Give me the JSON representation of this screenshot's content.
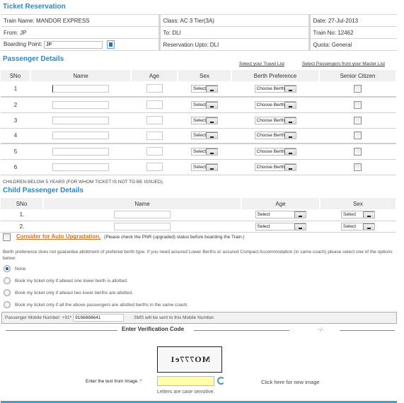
{
  "page_title": "Ticket Reservation",
  "train_info": {
    "train_name": "Train Name: MANDOR EXPRESS",
    "class": "Class: AC 3 Tier(3A)",
    "date": "Date: 27-Jul-2013",
    "from": "From: JP",
    "to": "To: DLI",
    "train_no": "Train No: 12462",
    "boarding_label": "Boarding Point:",
    "boarding_value": "JP",
    "reservation_upto": "Reservation Upto: DLI",
    "quota": "Quota: General"
  },
  "passenger_section": {
    "title": "Passenger Details",
    "link_travel_list": "Select your Travel List",
    "link_master_list": "Select Passengers from your Master List",
    "headers": [
      "SNo",
      "Name",
      "Age",
      "Sex",
      "Berth Preference",
      "Senior Citizen"
    ],
    "sex_placeholder": "Select",
    "berth_placeholder": "Choose Berth",
    "rows": [
      {
        "sno": "1"
      },
      {
        "sno": "2"
      },
      {
        "sno": "3"
      },
      {
        "sno": "4"
      },
      {
        "sno": "5"
      },
      {
        "sno": "6"
      }
    ]
  },
  "children_note": "CHILDREN BELOW 5 YEARS (FOR WHOM TICKET IS NOT TO BE ISSUED).",
  "child_section": {
    "title": "Child Passenger Details",
    "headers": [
      "SNo",
      "Name",
      "Age",
      "Sex"
    ],
    "age_placeholder": "Select",
    "sex_placeholder": "Select",
    "rows": [
      {
        "sno": "1."
      },
      {
        "sno": "2."
      }
    ]
  },
  "auto_upgrade": {
    "link": "Consider for Auto Upgradation.",
    "note": "(Please check the PNR (upgraded) status before boarding the Train.)"
  },
  "berth_note": "Berth preference does not guarantee allottment of prefered berth type. If you need assured Lower Berths or assured Compact Accommodation (in same coach) please select one of the options below:",
  "options": [
    {
      "label": "None",
      "selected": true
    },
    {
      "label": "Book my ticket only if atleast one lower berth is allotted.",
      "selected": false
    },
    {
      "label": "Book my ticket only if atleast two lower berths are allotted.",
      "selected": false
    },
    {
      "label": "Book my ticket only if all the above passengers are allotted berths in the same coach.",
      "selected": false
    }
  ],
  "mobile": {
    "label": "Passenger Mobile Number: +91",
    "required": "*",
    "value": "9166888641",
    "note": "SMS will be sent to this Mobile Number."
  },
  "verification": {
    "title": "Enter Verification Code",
    "captcha_text": "MO777e1",
    "input_label": "Enter the text from Image :",
    "required": "*",
    "new_image_link": "Click here for new image",
    "case_note": "Letters are case sensitive."
  },
  "colors": {
    "heading": "#1c8ccf",
    "link_orange": "#e0701a",
    "captcha_input": "#ffffa8",
    "bar": "#4a9ac9"
  }
}
